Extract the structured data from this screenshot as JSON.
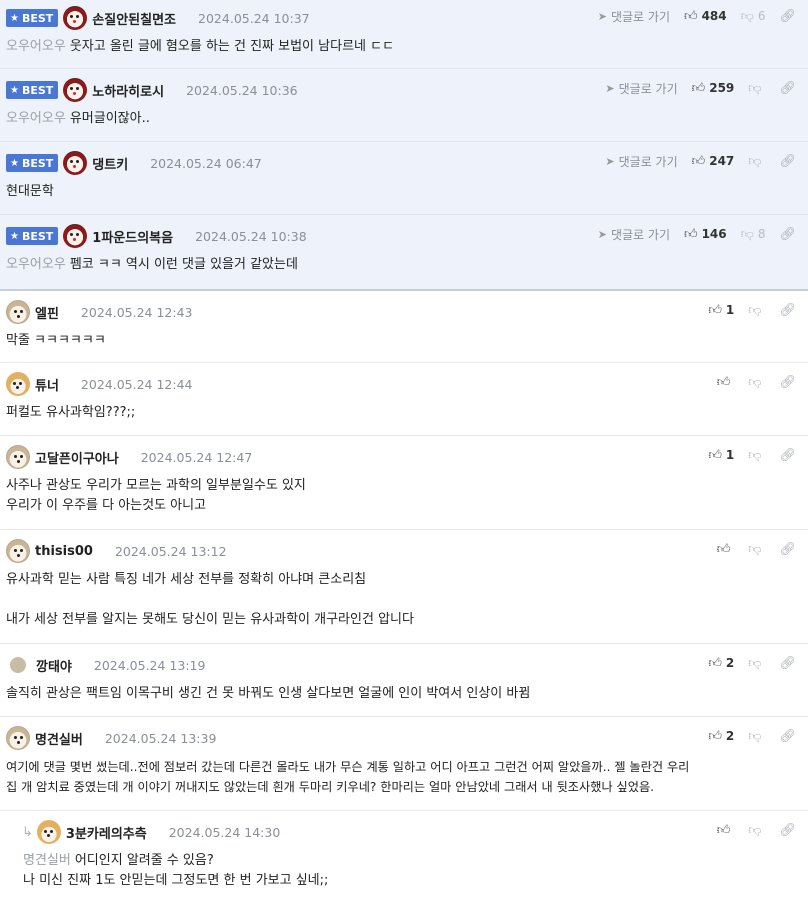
{
  "labels": {
    "best": "BEST",
    "goto": "댓글로 가기"
  },
  "comments": [
    {
      "best": true,
      "avatar": "red",
      "nick": "손질안된칠면조",
      "date": "2024.05.24 10:37",
      "up": "484",
      "down": "6",
      "quote": "오우어오우",
      "lines": [
        "웃자고 올린 글에 혐오를 하는 건 진짜 보법이 남다르네 ㄷㄷ"
      ]
    },
    {
      "best": true,
      "avatar": "red",
      "nick": "노하라히로시",
      "date": "2024.05.24 10:36",
      "up": "259",
      "down": "",
      "quote": "오우어오우",
      "lines": [
        "유머글이잖아.."
      ]
    },
    {
      "best": true,
      "avatar": "red",
      "nick": "댕트키",
      "date": "2024.05.24 06:47",
      "up": "247",
      "down": "",
      "quote": "",
      "lines": [
        "현대문학"
      ]
    },
    {
      "best": true,
      "avatar": "red",
      "nick": "1파운드의복음",
      "date": "2024.05.24 10:38",
      "up": "146",
      "down": "8",
      "quote": "오우어오우",
      "lines": [
        "펨코 ㅋㅋ 역시 이런 댓글 있을거 같았는데"
      ]
    },
    {
      "best": false,
      "avatar": "dog",
      "nick": "엘핀",
      "date": "2024.05.24 12:43",
      "up": "1",
      "down": "",
      "quote": "",
      "lines": [
        "막줄 ㅋㅋㅋㅋㅋㅋ"
      ]
    },
    {
      "best": false,
      "avatar": "fox",
      "nick": "튜너",
      "date": "2024.05.24 12:44",
      "up": "",
      "down": "",
      "quote": "",
      "lines": [
        "퍼컬도 유사과학임???;;"
      ]
    },
    {
      "best": false,
      "avatar": "dog",
      "nick": "고달픈이구아나",
      "date": "2024.05.24 12:47",
      "up": "1",
      "down": "",
      "quote": "",
      "lines": [
        "사주나 관상도 우리가 모르는 과학의 일부분일수도 있지",
        "우리가 이 우주를 다 아는것도 아니고"
      ]
    },
    {
      "best": false,
      "avatar": "dog",
      "nick": "thisis00",
      "date": "2024.05.24 13:12",
      "up": "",
      "down": "",
      "quote": "",
      "lines": [
        "유사과학 믿는 사람 특징 네가 세상 전부를 정확히 아냐며 큰소리침",
        "",
        "내가 세상 전부를 알지는 못해도 당신이 믿는 유사과학이 개구라인건 압니다"
      ]
    },
    {
      "best": false,
      "avatar": "plain",
      "nick": "깡태야",
      "date": "2024.05.24 13:19",
      "up": "2",
      "down": "",
      "quote": "",
      "lines": [
        "솔직히 관상은 팩트임 이목구비 생긴 건 못 바꿔도 인생 살다보면 얼굴에 인이 박여서 인상이 바뀜"
      ]
    },
    {
      "best": false,
      "avatar": "dog",
      "nick": "명견실버",
      "date": "2024.05.24 13:39",
      "up": "2",
      "down": "",
      "quote": "",
      "lines": [
        "여기에 댓글 몇번 썼는데..전에 점보러 갔는데 다른건 몰라도 내가 무슨 계통 일하고 어디 아프고 그런건 어찌 알았을까.. 젤 놀란건 우리",
        "집 개 암치료 중였는데 개 이야기 꺼내지도 않았는데 흰개 두마리 키우네? 한마리는 얼마 안남았네 그래서 내 뒷조사했나 싶었음."
      ]
    },
    {
      "best": false,
      "reply": true,
      "avatar": "fox",
      "nick": "3분카레의추측",
      "date": "2024.05.24 14:30",
      "up": "",
      "down": "",
      "quote": "명견실버",
      "lines": [
        "어디인지 알려줄 수 있음?",
        "나 미신 진짜 1도 안믿는데 그정도면 한 번 가보고 싶네;;"
      ]
    }
  ]
}
